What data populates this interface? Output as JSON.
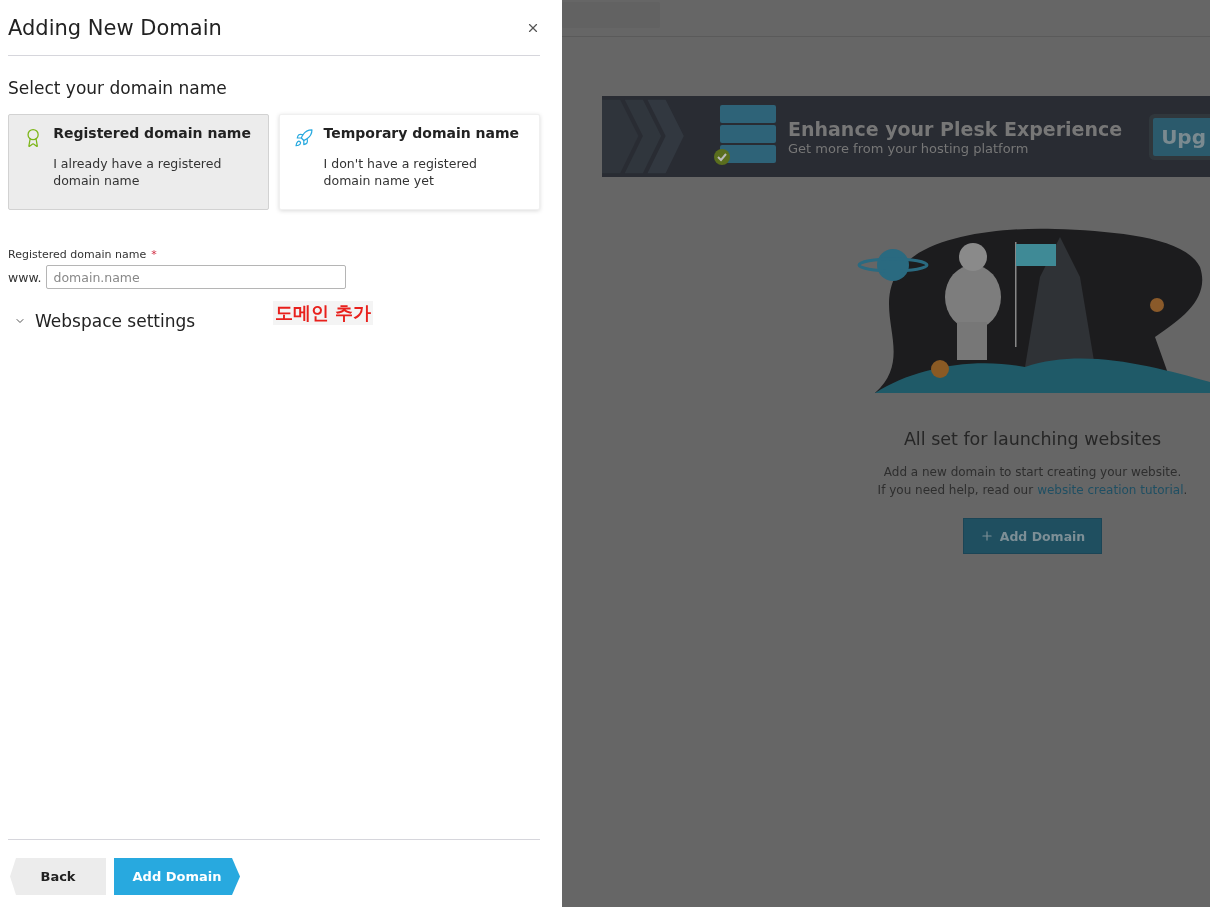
{
  "dialog": {
    "title": "Adding New Domain",
    "section_title": "Select your domain name",
    "options": [
      {
        "kind": "registered",
        "title": "Registered domain name",
        "description": "I already have a registered domain name",
        "selected": true
      },
      {
        "kind": "temporary",
        "title": "Temporary domain name",
        "description": "I don't have a registered domain name yet",
        "selected": false
      }
    ],
    "field": {
      "label": "Registered domain name",
      "required_mark": "*",
      "prefix": "www.",
      "placeholder": "domain.name"
    },
    "annotation": "도메인 추가",
    "webspace": {
      "label": "Webspace settings",
      "expanded": false
    },
    "buttons": [
      {
        "kind": "back",
        "label": "Back"
      },
      {
        "kind": "next",
        "label": "Add Domain"
      }
    ]
  },
  "background": {
    "banner": {
      "title": "Enhance your Plesk Experience",
      "subtitle": "Get more from your hosting platform",
      "button": "Upg"
    },
    "empty_state": {
      "title": "All set for launching websites",
      "line_1": "Add a new domain to start creating your website.",
      "line_2": "If you need help, read our",
      "link": "website creation tutorial",
      "line_2_end": ".",
      "button": "Add Domain"
    }
  }
}
